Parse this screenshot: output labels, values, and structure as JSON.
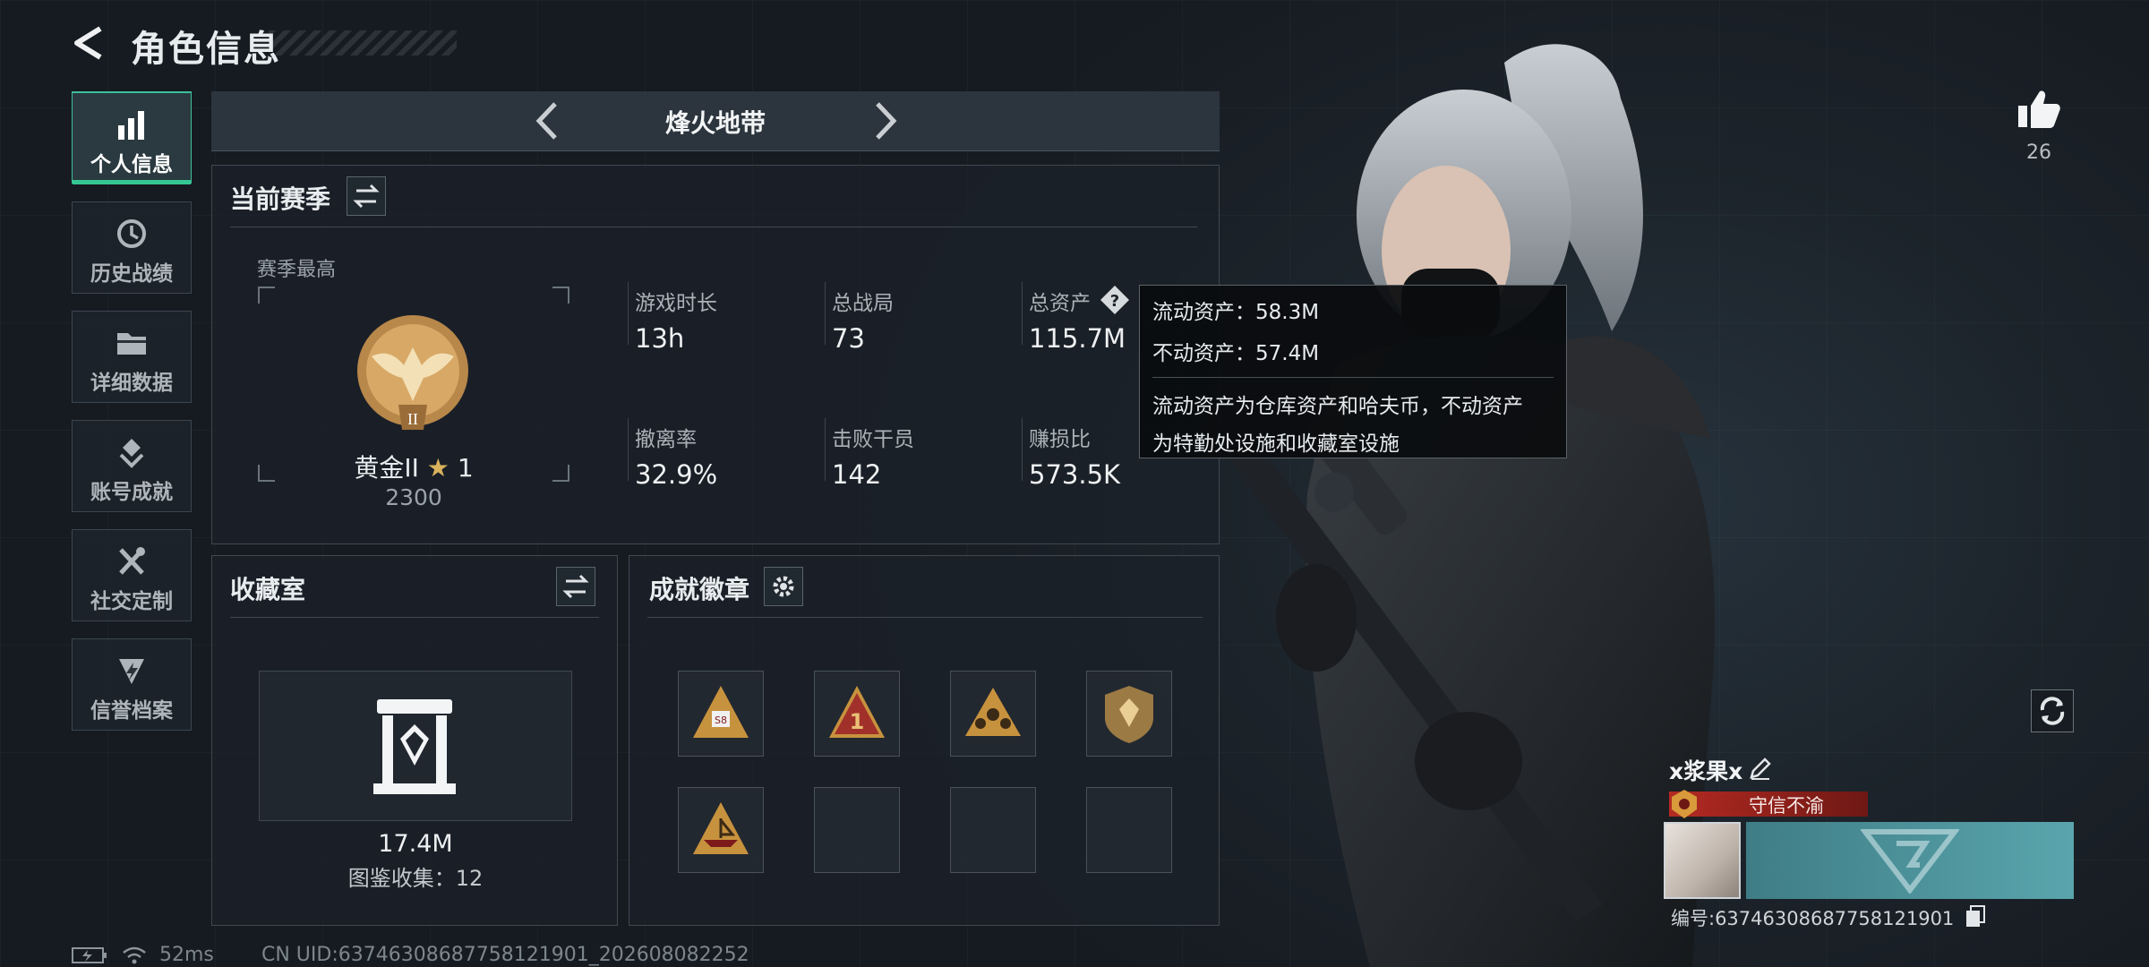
{
  "header": {
    "title": "角色信息"
  },
  "sidebar": {
    "items": [
      {
        "label": "个人信息",
        "icon": "bar-chart-icon",
        "active": true
      },
      {
        "label": "历史战绩",
        "icon": "history-clock-icon"
      },
      {
        "label": "详细数据",
        "icon": "folder-icon"
      },
      {
        "label": "账号成就",
        "icon": "achievement-icon"
      },
      {
        "label": "社交定制",
        "icon": "tools-icon"
      },
      {
        "label": "信誉档案",
        "icon": "credit-shield-icon"
      }
    ]
  },
  "mode": {
    "title": "烽火地带"
  },
  "season": {
    "title": "当前赛季",
    "best_label": "赛季最高",
    "rank_name": "黄金II",
    "rank_stars": "1",
    "rank_points": "2300",
    "stats": [
      {
        "label": "游戏时长",
        "value": "13h"
      },
      {
        "label": "总战局",
        "value": "73"
      },
      {
        "label": "总资产",
        "value": "115.7M"
      },
      {
        "label": "撤离率",
        "value": "32.9%"
      },
      {
        "label": "击败干员",
        "value": "142"
      },
      {
        "label": "赚损比",
        "value": "573.5K"
      }
    ]
  },
  "tooltip": {
    "line1": "流动资产：58.3M",
    "line2": "不动资产：57.4M",
    "desc1": "流动资产为仓库资产和哈夫币，不动资产",
    "desc2": "为特勤处设施和收藏室设施"
  },
  "collection": {
    "title": "收藏室",
    "value": "17.4M",
    "count_text": "图鉴收集：12"
  },
  "achievements": {
    "title": "成就徽章",
    "badges": [
      "badge-s8-icon",
      "badge-rank1-icon",
      "badge-squad-icon",
      "badge-shield-icon",
      "badge-ship-icon",
      "",
      "",
      ""
    ]
  },
  "profile": {
    "likes": "26",
    "name": "x浆果x",
    "title_tag": "守信不渝",
    "id_text": "编号:6374630868775812190​1"
  },
  "status": {
    "ping": "52ms",
    "uid": "CN UID:6374630868775812190​1_202608082252"
  },
  "colors": {
    "accent": "#35c792",
    "tag_red": "#8b1b1b",
    "card_teal": "#5aa5ad"
  }
}
